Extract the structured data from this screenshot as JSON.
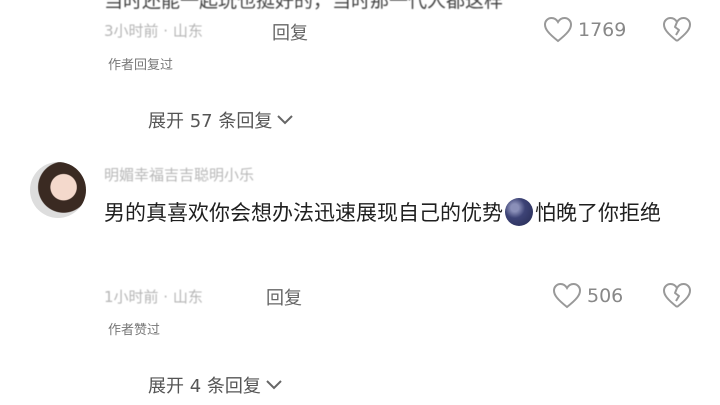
{
  "comment1": {
    "partial_text": "当时还能一起玩也挺好的，当时那一代人都这样",
    "time_location": "3小时前 · 山东",
    "reply_label": "回复",
    "like_count": "1769",
    "author_note": "作者回复过",
    "expand_label": "展开 57 条回复"
  },
  "comment2": {
    "username": "明媚幸福吉吉聪明小乐",
    "text_part1": "男的真喜欢你会想办法迅速展现自己的优势",
    "text_part2": "怕晚了你拒绝",
    "time_location": "1小时前 · 山东",
    "reply_label": "回复",
    "like_count": "506",
    "author_note": "作者赞过",
    "expand_label": "展开 4 条回复"
  },
  "icons": {
    "like": "heart-outline-icon",
    "dislike": "broken-heart-icon",
    "expand": "chevron-down-icon",
    "emoji": "dark-ball-emoji-icon"
  },
  "colors": {
    "text_primary": "#1f1f1f",
    "meta": "#b5b5b5",
    "secondary": "#777777"
  }
}
